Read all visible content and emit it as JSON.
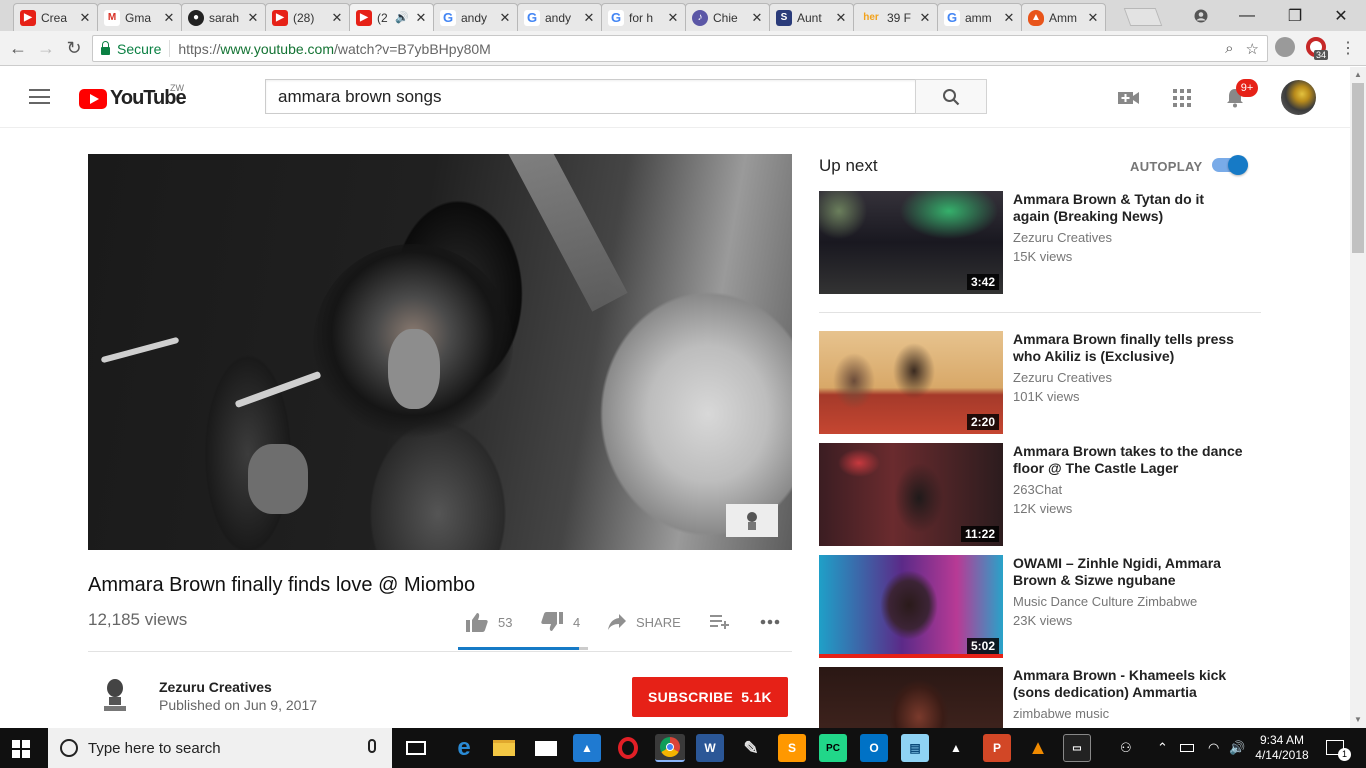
{
  "browser": {
    "tabs": [
      {
        "icon": "youtube-icon",
        "color": "#e62117",
        "title": "Crea"
      },
      {
        "icon": "gmail-icon",
        "color": "#d93025",
        "title": "Gma"
      },
      {
        "icon": "github-icon",
        "color": "#222222",
        "title": "sarah"
      },
      {
        "icon": "youtube-icon",
        "color": "#e62117",
        "title": "(28) "
      },
      {
        "icon": "youtube-icon",
        "color": "#e62117",
        "title": "(2"
      },
      {
        "icon": "google-icon",
        "color": "#4285f4",
        "title": "andy"
      },
      {
        "icon": "google-icon",
        "color": "#4285f4",
        "title": "andy"
      },
      {
        "icon": "google-icon",
        "color": "#4285f4",
        "title": "for h"
      },
      {
        "icon": "guitar-icon",
        "color": "#5b57a6",
        "title": "Chie"
      },
      {
        "icon": "s-icon",
        "color": "#2a3b7a",
        "title": "Aunt"
      },
      {
        "icon": "her-icon",
        "color": "#f2a21b",
        "title": "39 F"
      },
      {
        "icon": "google-icon",
        "color": "#4285f4",
        "title": "amm"
      },
      {
        "icon": "fire-icon",
        "color": "#e8541a",
        "title": "Amm"
      }
    ],
    "secure_label": "Secure",
    "url_scheme": "https://",
    "url_host": "www.youtube.com",
    "url_path": "/watch?v=B7ybBHpy80M",
    "extension_badge": "34"
  },
  "youtube": {
    "country_code": "ZW",
    "logo_text": "YouTube",
    "search_query": "ammara brown songs",
    "notification_count": "9+"
  },
  "video": {
    "title": "Ammara Brown finally finds love @ Miombo",
    "views": "12,185 views",
    "likes": "53",
    "dislikes": "4",
    "like_ratio": 0.93,
    "share_label": "SHARE",
    "channel": "Zezuru Creatives",
    "published": "Published on Jun 9, 2017",
    "subscribe_label": "SUBSCRIBE",
    "subscriber_count": "5.1K"
  },
  "sidebar": {
    "up_next_label": "Up next",
    "autoplay_label": "AUTOPLAY",
    "autoplay_on": true,
    "recommendations": [
      {
        "title": "Ammara Brown & Tytan do it again (Breaking News)",
        "channel": "Zezuru Creatives",
        "views": "15K views",
        "duration": "3:42",
        "watched": 0
      },
      {
        "title": "Ammara Brown finally tells press who Akiliz is (Exclusive)",
        "channel": "Zezuru Creatives",
        "views": "101K views",
        "duration": "2:20",
        "watched": 0
      },
      {
        "title": "Ammara Brown takes to the dance floor @ The Castle Lager",
        "channel": "263Chat",
        "views": "12K views",
        "duration": "11:22",
        "watched": 0
      },
      {
        "title": "OWAMI – Zinhle Ngidi, Ammara Brown & Sizwe ngubane",
        "channel": "Music Dance Culture Zimbabwe",
        "views": "23K views",
        "duration": "5:02",
        "watched": 1
      },
      {
        "title": "Ammara Brown - Khameels kick (sons dedication) Ammartia",
        "channel": "zimbabwe music",
        "views": "",
        "duration": "",
        "watched": 0
      }
    ]
  },
  "taskbar": {
    "search_placeholder": "Type here to search",
    "time": "9:34 AM",
    "date": "4/14/2018",
    "notification_count": "1"
  }
}
